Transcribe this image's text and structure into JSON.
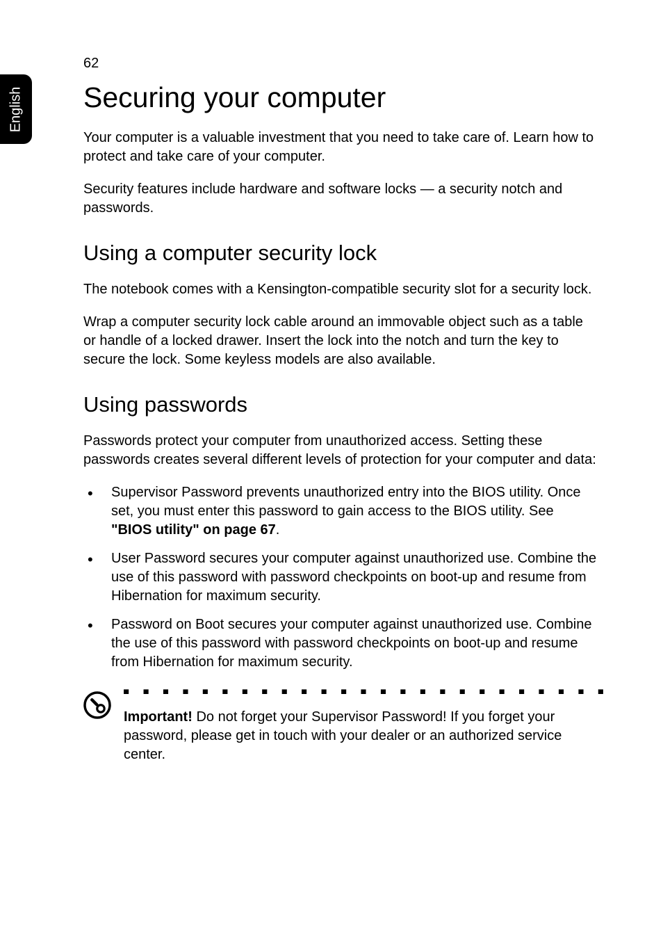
{
  "pageNumber": "62",
  "sideTab": "English",
  "heading": "Securing your computer",
  "intro1": "Your computer is a valuable investment that you need to take care of. Learn how to protect and take care of your computer.",
  "intro2": "Security features include hardware and software locks — a security notch and passwords.",
  "section1": {
    "title": "Using a computer security lock",
    "p1": "The notebook comes with a Kensington-compatible security slot for a security lock.",
    "p2": "Wrap a computer security lock cable around an immovable object such as a table or handle of a locked drawer. Insert the lock into the notch and turn the key to secure the lock. Some keyless models are also available."
  },
  "section2": {
    "title": "Using passwords",
    "p1": "Passwords protect your computer from unauthorized access. Setting these passwords creates several different levels of protection for your computer and data:",
    "bullets": [
      {
        "pre": "Supervisor Password prevents unauthorized entry into the BIOS utility. Once set, you must enter this password to gain access to the BIOS utility. See ",
        "bold": "\"BIOS utility\" on page 67",
        "post": "."
      },
      {
        "pre": "User Password secures your computer against unauthorized use. Combine the use of this password with password checkpoints on boot-up and resume from Hibernation for maximum security.",
        "bold": "",
        "post": ""
      },
      {
        "pre": "Password on Boot secures your computer against unauthorized use. Combine the use of this password with password checkpoints on boot-up and resume from Hibernation for maximum security.",
        "bold": "",
        "post": ""
      }
    ],
    "note": {
      "label": "Important!",
      "text": " Do not forget your Supervisor Password! If you forget your password, please get in touch with your dealer or an authorized service center."
    }
  },
  "dots": "■ ■ ■ ■ ■ ■ ■ ■ ■ ■ ■ ■ ■ ■ ■ ■ ■ ■ ■ ■ ■ ■ ■ ■ ■ ■ ■ ■ ■ ■ ■ ■ ■ ■ ■ ■ ■ ■ ■ ■ ■ ■ ■ ■ ■ ■ ■"
}
